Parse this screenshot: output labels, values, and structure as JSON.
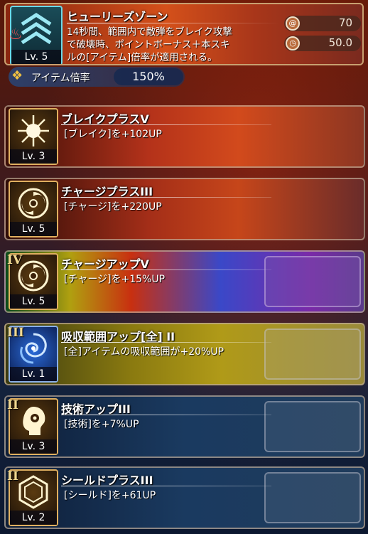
{
  "main_skill": {
    "name": "ヒューリーズゾーン",
    "description_lines": [
      "14秒間、範囲内で敵弾をブレイク攻撃",
      "で破壊時、ポイントボーナス＋本スキ",
      "ルの[アイテム]倍率が適用される。"
    ],
    "level": "Lv. 5",
    "icon": "chevron-rank-icon",
    "stats": [
      {
        "icon": "swirl-charge-icon",
        "value": "70"
      },
      {
        "icon": "clock-timer-icon",
        "value": "50.0"
      }
    ],
    "item_rate": {
      "label": "アイテム倍率",
      "value": "150%",
      "icon": "gift-items-icon"
    }
  },
  "sub_skills": [
    {
      "rank": "",
      "name": "ブレイクプラスV",
      "description": "[ブレイク]を+102UP",
      "level": "Lv. 3",
      "icon": "burst-icon"
    },
    {
      "rank": "",
      "name": "チャージプラスIII",
      "description": "[チャージ]を+220UP",
      "level": "Lv. 5",
      "icon": "swirl-icon"
    },
    {
      "rank": "IV",
      "name": "チャージアップV",
      "description": "[チャージ]を+15%UP",
      "level": "Lv. 5",
      "icon": "swirl-icon"
    },
    {
      "rank": "III",
      "name": "吸収範囲アップ[全] II",
      "description": "[全]アイテムの吸収範囲が+20%UP",
      "level": "Lv. 1",
      "icon": "vortex-icon"
    },
    {
      "rank": "II",
      "name": "技術アップIII",
      "description": "[技術]を+7%UP",
      "level": "Lv. 3",
      "icon": "head-skill-icon"
    },
    {
      "rank": "II",
      "name": "シールドプラスIII",
      "description": "[シールド]を+61UP",
      "level": "Lv. 2",
      "icon": "hexagon-shield-icon"
    }
  ]
}
